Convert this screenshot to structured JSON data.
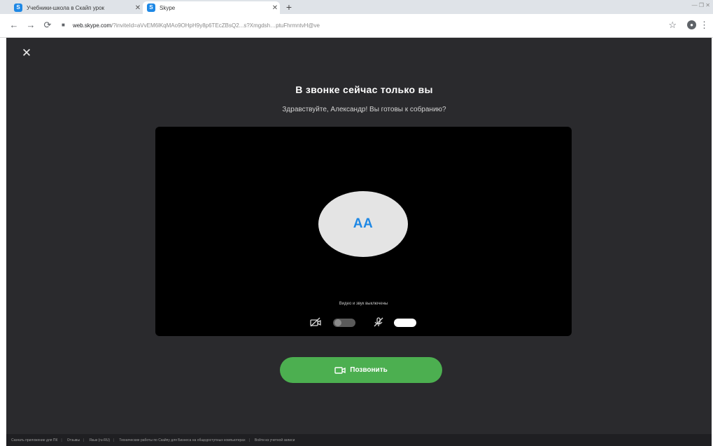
{
  "browser": {
    "tabs": [
      {
        "title": "Учебники-школа в Скайп урок",
        "favicon": "S",
        "active": false
      },
      {
        "title": "Skype",
        "favicon": "S",
        "active": true
      }
    ],
    "new_tab": "+",
    "window_controls": "— ❐ ✕",
    "url_host": "web.skype.com",
    "url_path": "/?inviteId=aVvEM6lKqMAo9OHpH9y8p6TEcZBsQ2...s?Xmgdsh…ptuFhrmntvH@ve"
  },
  "app": {
    "title": "В звонке сейчас только вы",
    "subtitle": "Здравствуйте, Александр! Вы готовы к собранию?",
    "avatar_initials": "AA",
    "av_status": "Видео и звук выключены",
    "video_toggle_on": false,
    "mic_toggle_on": true,
    "call_button": "Позвонить"
  },
  "footer": {
    "links": [
      "Скачать приложение для ПК",
      "Отзывы",
      "Язык (ru-RU)",
      "Технические работы по Скайпу для Бизнеса на общедоступных компьютерах",
      "Войти из учетной записи"
    ]
  },
  "colors": {
    "app_background": "#2a2a2d",
    "preview_background": "#000000",
    "call_button": "#4caf50",
    "avatar_text": "#1e88e5"
  }
}
